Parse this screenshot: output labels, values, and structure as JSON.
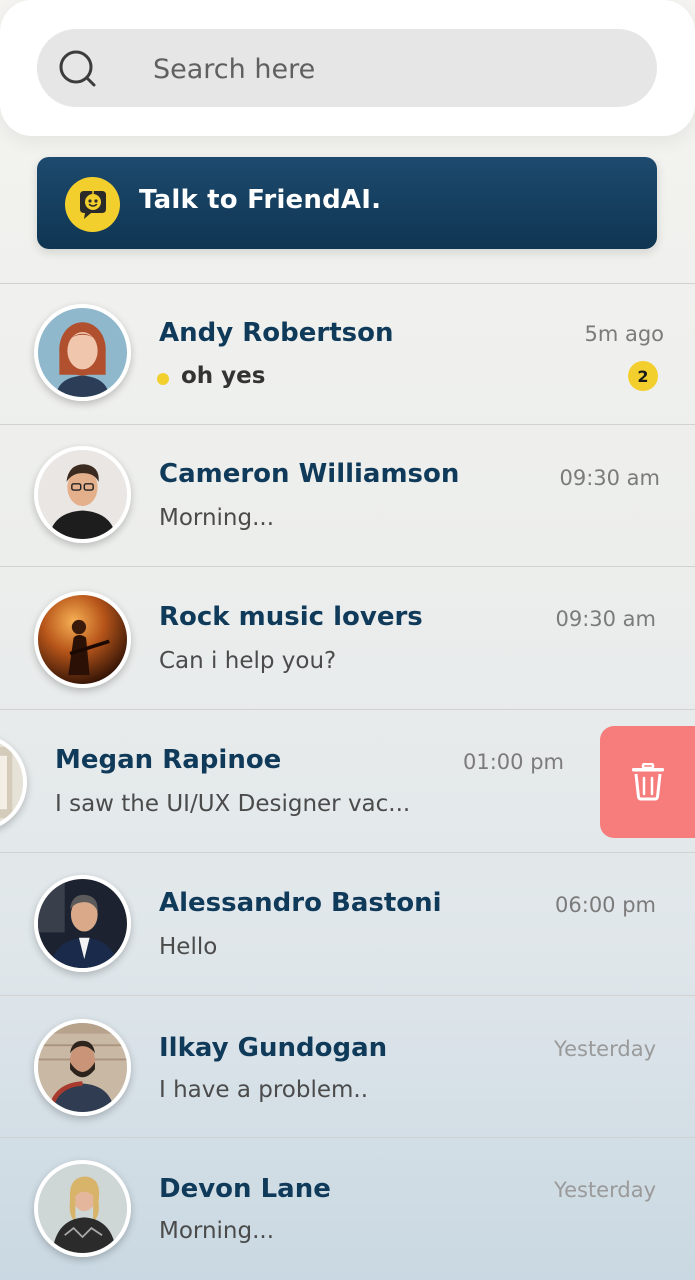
{
  "search": {
    "placeholder": "Search here",
    "value": ""
  },
  "ai_banner": {
    "label": "Talk to FriendAI."
  },
  "chats": [
    {
      "name": "Andy Robertson",
      "message": "oh yes",
      "time": "5m ago",
      "unread": "2"
    },
    {
      "name": "Cameron Williamson",
      "message": "Morning...",
      "time": "09:30 am"
    },
    {
      "name": "Rock music lovers",
      "message": "Can i help you?",
      "time": "09:30 am"
    },
    {
      "name": "Megan Rapinoe",
      "message": "I saw the UI/UX Designer vac...",
      "time": "01:00 pm"
    },
    {
      "name": "Alessandro Bastoni",
      "message": "Hello",
      "time": "06:00 pm"
    },
    {
      "name": "Ilkay Gundogan",
      "message": "I have a problem..",
      "time": "Yesterday"
    },
    {
      "name": "Devon Lane",
      "message": "Morning...",
      "time": "Yesterday"
    }
  ],
  "colors": {
    "accent": "#f3cf2d",
    "banner": "#103a5a",
    "delete": "#f77c7c"
  },
  "icons": {
    "search": "search-icon",
    "ai": "ai-chat-icon",
    "delete": "trash-icon"
  }
}
